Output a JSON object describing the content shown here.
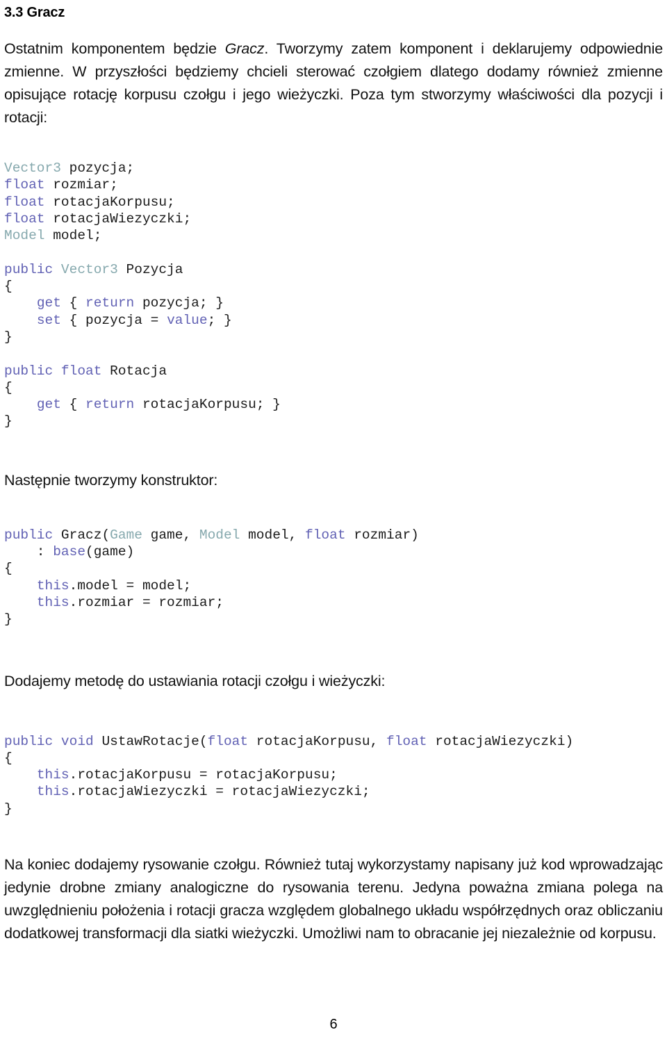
{
  "document": {
    "heading": "3.3 Gracz",
    "page_number": "6"
  },
  "paragraphs": {
    "intro_part1": "Ostatnim komponentem będzie ",
    "intro_italic": "Gracz",
    "intro_part2": ". Tworzymy zatem komponent i deklarujemy odpowiednie zmienne. W przyszłości będziemy chcieli sterować czołgiem dlatego dodamy również zmienne opisujące rotację korpusu czołgu i jego wieżyczki. Poza tym stworzymy właściwości dla pozycji i rotacji:",
    "constructor_lead": "Następnie tworzymy konstruktor:",
    "method_lead": "Dodajemy metodę do ustawiania rotacji czołgu i wieżyczki:",
    "closing": "Na koniec dodajemy rysowanie czołgu. Również tutaj wykorzystamy napisany już kod wprowadzając jedynie drobne zmiany analogiczne do rysowania terenu. Jedyna poważna zmiana polega na uwzględnieniu położenia i rotacji gracza względem globalnego układu współrzędnych oraz obliczaniu dodatkowej transformacji dla siatki wieżyczki. Umożliwi nam to obracanie jej niezależnie od korpusu."
  },
  "code_blocks": {
    "fields_and_properties": "Vector3 pozycja;\nfloat rozmiar;\nfloat rotacjaKorpusu;\nfloat rotacjaWiezyczki;\nModel model;\n\npublic Vector3 Pozycja\n{\n    get { return pozycja; }\n    set { pozycja = value; }\n}\n\npublic float Rotacja\n{\n    get { return rotacjaKorpusu; }\n}",
    "constructor": "public Gracz(Game game, Model model, float rozmiar)\n    : base(game)\n{\n    this.model = model;\n    this.rozmiar = rozmiar;\n}",
    "set_rotation_method": "public void UstawRotacje(float rotacjaKorpusu, float rotacjaWiezyczki)\n{\n    this.rotacjaKorpusu = rotacjaKorpusu;\n    this.rotacjaWiezyczki = rotacjaWiezyczki;\n}"
  },
  "syntax": {
    "keywords": [
      "public",
      "float",
      "void",
      "get",
      "set",
      "return",
      "value",
      "base",
      "this"
    ],
    "types": [
      "Vector3",
      "Model",
      "Game"
    ],
    "keyword_color": "#6161b4",
    "type_color": "#85a8ad",
    "plain_color": "#1a1a1a"
  }
}
